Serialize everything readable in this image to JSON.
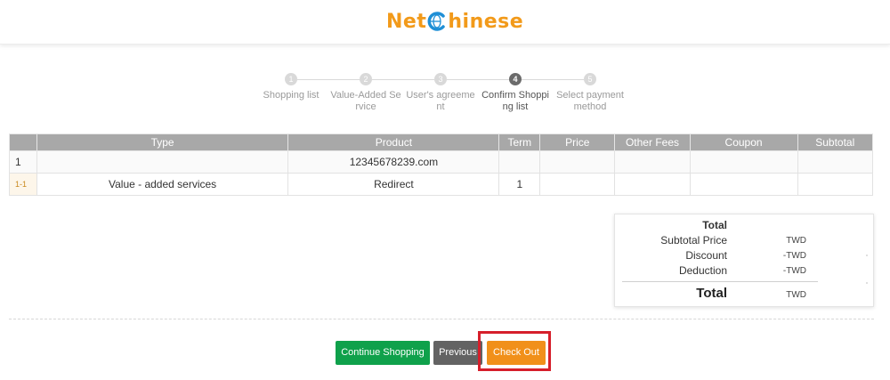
{
  "header": {
    "logo_part1": "Net",
    "logo_part2": "hinese",
    "brand_color": "#f29a1a",
    "globe_color": "#1f8fd6"
  },
  "steps": [
    {
      "num": "1",
      "label": "Shopping list"
    },
    {
      "num": "2",
      "label": "Value-Added Service"
    },
    {
      "num": "3",
      "label": "User's agreement"
    },
    {
      "num": "4",
      "label": "Confirm Shopping list",
      "active": true
    },
    {
      "num": "5",
      "label": "Select payment method"
    }
  ],
  "table": {
    "headers": [
      "",
      "Type",
      "Product",
      "Term",
      "Price",
      "Other Fees",
      "Coupon",
      "Subtotal"
    ],
    "rows": [
      [
        "1",
        "",
        "12345678239.com",
        "",
        "",
        "",
        "",
        ""
      ],
      [
        "1-1",
        "Value - added services",
        "Redirect",
        "1",
        "",
        "",
        "",
        ""
      ]
    ]
  },
  "totals": {
    "heading": "Total",
    "subtotal_label": "Subtotal Price",
    "subtotal_value": "TWD",
    "discount_label": "Discount",
    "discount_value": "-TWD",
    "deduction_label": "Deduction",
    "deduction_value": "-TWD",
    "total_label": "Total",
    "total_value": "TWD"
  },
  "buttons": {
    "continue": "Continue Shopping",
    "previous": "Previous",
    "checkout": "Check Out"
  },
  "colors": {
    "continue_btn": "#0fa14b",
    "previous_btn": "#636363",
    "checkout_btn": "#f1901a",
    "highlight_border": "#d61f2b"
  }
}
